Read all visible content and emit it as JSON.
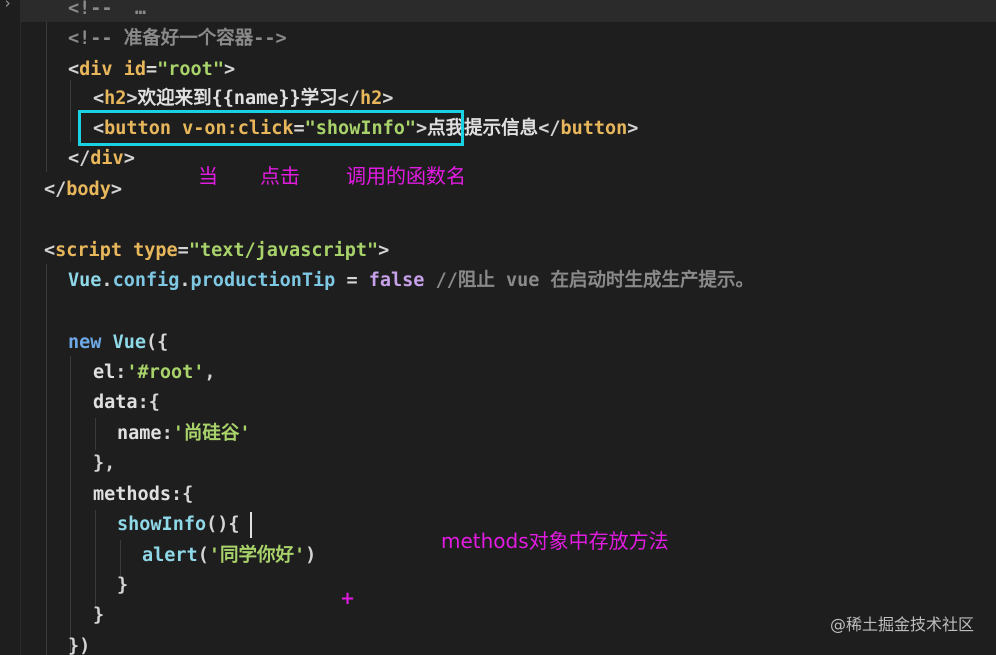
{
  "editor": {
    "lines": [
      {
        "tokens": [
          {
            "c": "t-comment",
            "v": "<!--  …"
          }
        ]
      },
      {
        "tokens": [
          {
            "c": "t-comment",
            "v": "<!-- 准备好一个容器-->"
          }
        ]
      },
      {
        "tokens": [
          {
            "c": "t-punct",
            "v": "<"
          },
          {
            "c": "t-tag",
            "v": "div "
          },
          {
            "c": "t-attr",
            "v": "id"
          },
          {
            "c": "t-punct",
            "v": "="
          },
          {
            "c": "t-str",
            "v": "\"root\""
          },
          {
            "c": "t-punct",
            "v": ">"
          }
        ]
      },
      {
        "tokens": [
          {
            "c": "t-punct",
            "v": "<"
          },
          {
            "c": "t-tag",
            "v": "h2"
          },
          {
            "c": "t-punct",
            "v": ">"
          },
          {
            "c": "t-text",
            "v": "欢迎来到{{name}}学习"
          },
          {
            "c": "t-punct",
            "v": "</"
          },
          {
            "c": "t-tag",
            "v": "h2"
          },
          {
            "c": "t-punct",
            "v": ">"
          }
        ]
      },
      {
        "tokens": [
          {
            "c": "t-punct",
            "v": "<"
          },
          {
            "c": "t-tag",
            "v": "button "
          },
          {
            "c": "t-attr",
            "v": "v-on:click"
          },
          {
            "c": "t-punct",
            "v": "="
          },
          {
            "c": "t-str",
            "v": "\"showInfo\""
          },
          {
            "c": "t-punct",
            "v": ">"
          },
          {
            "c": "t-text",
            "v": "点我提示信息"
          },
          {
            "c": "t-punct",
            "v": "</"
          },
          {
            "c": "t-tag",
            "v": "button"
          },
          {
            "c": "t-punct",
            "v": ">"
          }
        ]
      },
      {
        "tokens": [
          {
            "c": "t-punct",
            "v": "</"
          },
          {
            "c": "t-tag",
            "v": "div"
          },
          {
            "c": "t-punct",
            "v": ">"
          }
        ]
      },
      {
        "tokens": [
          {
            "c": "t-punct",
            "v": "</"
          },
          {
            "c": "t-tag",
            "v": "body"
          },
          {
            "c": "t-punct",
            "v": ">"
          }
        ]
      },
      {
        "tokens": []
      },
      {
        "tokens": [
          {
            "c": "t-punct",
            "v": "<"
          },
          {
            "c": "t-tag",
            "v": "script "
          },
          {
            "c": "t-attr",
            "v": "type"
          },
          {
            "c": "t-punct",
            "v": "="
          },
          {
            "c": "t-str",
            "v": "\"text/javascript\""
          },
          {
            "c": "t-punct",
            "v": ">"
          }
        ]
      },
      {
        "tokens": [
          {
            "c": "t-fn",
            "v": "Vue"
          },
          {
            "c": "t-punct",
            "v": "."
          },
          {
            "c": "t-prop",
            "v": "config"
          },
          {
            "c": "t-punct",
            "v": "."
          },
          {
            "c": "t-prop",
            "v": "productionTip"
          },
          {
            "c": "t-punct",
            "v": " = "
          },
          {
            "c": "t-bool",
            "v": "false"
          },
          {
            "c": "t-comment",
            "v": " //阻止 vue 在启动时生成生产提示。"
          }
        ]
      },
      {
        "tokens": []
      },
      {
        "tokens": [
          {
            "c": "t-kw",
            "v": "new "
          },
          {
            "c": "t-fn",
            "v": "Vue"
          },
          {
            "c": "t-punct",
            "v": "({"
          }
        ]
      },
      {
        "tokens": [
          {
            "c": "t-plain",
            "v": "el"
          },
          {
            "c": "t-punct",
            "v": ":"
          },
          {
            "c": "t-str",
            "v": "'#root'"
          },
          {
            "c": "t-punct",
            "v": ","
          }
        ]
      },
      {
        "tokens": [
          {
            "c": "t-plain",
            "v": "data"
          },
          {
            "c": "t-punct",
            "v": ":{"
          }
        ]
      },
      {
        "tokens": [
          {
            "c": "t-plain",
            "v": "name"
          },
          {
            "c": "t-punct",
            "v": ":"
          },
          {
            "c": "t-str",
            "v": "'尚硅谷'"
          }
        ]
      },
      {
        "tokens": [
          {
            "c": "t-punct",
            "v": "},"
          }
        ]
      },
      {
        "tokens": [
          {
            "c": "t-plain",
            "v": "methods"
          },
          {
            "c": "t-punct",
            "v": ":{"
          }
        ]
      },
      {
        "tokens": [
          {
            "c": "t-fn",
            "v": "showInfo"
          },
          {
            "c": "t-punct",
            "v": "(){"
          }
        ]
      },
      {
        "tokens": [
          {
            "c": "t-fn",
            "v": "alert"
          },
          {
            "c": "t-punct",
            "v": "("
          },
          {
            "c": "t-str",
            "v": "'同学你好'"
          },
          {
            "c": "t-punct",
            "v": ")"
          }
        ]
      },
      {
        "tokens": [
          {
            "c": "t-punct",
            "v": "}"
          }
        ]
      },
      {
        "tokens": [
          {
            "c": "t-punct",
            "v": "}"
          }
        ]
      },
      {
        "tokens": [
          {
            "c": "t-punct",
            "v": "})"
          }
        ]
      }
    ]
  },
  "annotations": {
    "when": "当",
    "click": "点击",
    "fn_name": "调用的函数名",
    "methods_note": "methods对象中存放方法"
  },
  "watermark": "@稀土掘金技术社区",
  "colors": {
    "highlight_box": "#19d1e0",
    "annotation": "#e21be0"
  }
}
